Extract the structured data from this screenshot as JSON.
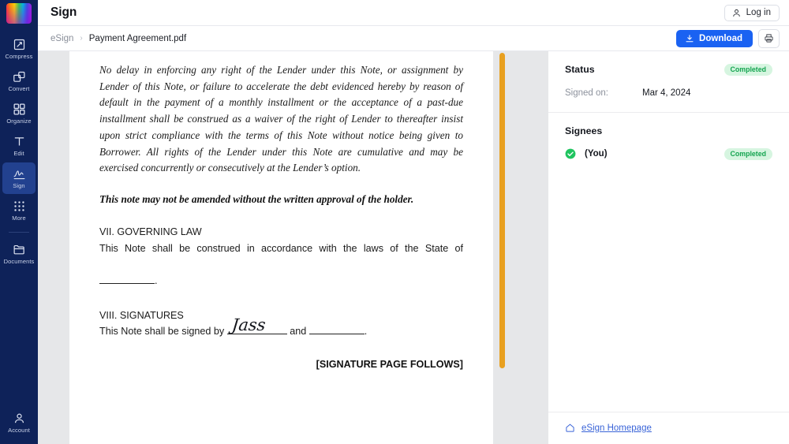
{
  "sidebar": {
    "logo_name": "rainbow-logo",
    "items": [
      {
        "label": "Compress",
        "icon": "compress-icon",
        "active": false
      },
      {
        "label": "Convert",
        "icon": "convert-icon",
        "active": false
      },
      {
        "label": "Organize",
        "icon": "organize-icon",
        "active": false
      },
      {
        "label": "Edit",
        "icon": "edit-icon",
        "active": false
      },
      {
        "label": "Sign",
        "icon": "sign-icon",
        "active": true
      },
      {
        "label": "More",
        "icon": "more-grid-icon",
        "active": false
      }
    ],
    "documents": {
      "label": "Documents",
      "icon": "folder-icon"
    },
    "account": {
      "label": "Account",
      "icon": "person-icon"
    },
    "bg_color": "#0e2259",
    "active_color": "#22418f"
  },
  "header": {
    "title": "Sign",
    "login_label": "Log in",
    "login_icon": "person-icon"
  },
  "breadcrumb": {
    "root": "eSign",
    "separator": "›",
    "current": "Payment Agreement.pdf",
    "download_label": "Download",
    "download_icon": "download-icon",
    "print_icon": "printer-icon",
    "accent_color": "#1a62f2"
  },
  "document": {
    "paragraph_1": "No delay in enforcing any right of the Lender under this Note, or assignment by Lender of this Note, or failure to accelerate the debt evidenced hereby by reason of default in the payment of a monthly installment or the acceptance of a past-due installment shall be construed as a waiver of the right of Lender to thereafter insist upon strict compliance with the terms of this Note without notice being given to Borrower. All rights of the Lender under this Note are cumulative and may be exercised concurrently or consecutively at the Lender’s option.",
    "bold_note": "This note may not be amended without the written approval of the holder.",
    "section_7_heading": "VII. GOVERNING LAW",
    "section_7_body": "This Note shall be construed in accordance with the laws of the State of",
    "section_7_trailing": ".",
    "section_8_heading": "VIII. SIGNATURES",
    "section_8_prefix": "This Note shall be signed by",
    "signature_value": "Jass",
    "section_8_middle": "and",
    "section_8_suffix": ".",
    "signature_page_follows": "[SIGNATURE PAGE FOLLOWS]",
    "scrollbar_color": "#e8a020"
  },
  "panel": {
    "status": {
      "title": "Status",
      "badge": "Completed",
      "signed_on_label": "Signed on:",
      "signed_on_value": "Mar 4, 2024"
    },
    "signees": {
      "title": "Signees",
      "rows": [
        {
          "name": "(You)",
          "badge": "Completed",
          "icon": "check-circle-icon"
        }
      ]
    },
    "footer": {
      "link": "eSign Homepage",
      "icon": "home-icon"
    },
    "badge_bg": "#d6f5e0",
    "badge_text_color": "#13a44f",
    "link_color": "#3a64d8"
  }
}
